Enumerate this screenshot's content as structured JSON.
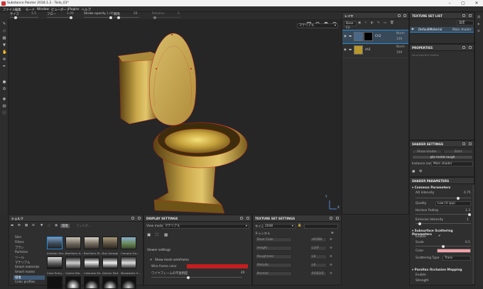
{
  "window": {
    "title": "Substance Painter 2018.1.2 - Toile_01*"
  },
  "menu": [
    "ファイル",
    "編集",
    "モード",
    "Window",
    "ビューポート",
    "Plugins",
    "ヘルプ"
  ],
  "toolbar": {
    "size_label": "サイズ",
    "size_value": "1.5",
    "flow_label": "フロー",
    "flow_value": "1.00",
    "stroke_opacity_label": "Stroke opacity",
    "stroke_opacity_value": "1.00",
    "spacing_label": "間隔",
    "spacing_value": "20",
    "rotation_label": "Rotation",
    "rotation_value": "0"
  },
  "viewport": {
    "mode": "マテリアル",
    "axis_y": "Y",
    "axis_x": "X"
  },
  "layers": {
    "title": "レイヤ",
    "blend": "Base Co",
    "items": [
      {
        "name": "Ch2",
        "blend": "Norm",
        "opacity": "100"
      },
      {
        "name": "ch1",
        "blend": "Norm",
        "opacity": "100"
      }
    ]
  },
  "texture_set_list": {
    "title": "TEXTURE SET LIST",
    "dropdown": "設定",
    "item": "DefaultMaterial",
    "shader": "Main shader"
  },
  "properties": {
    "title": "PROPERTIES",
    "empty": "No properties loaded"
  },
  "shader_settings": {
    "title": "SHADER SETTINGS",
    "buttons": [
      "Show shader",
      "Start"
    ],
    "shader_name": "pbr-metal-rough",
    "instance_label": "Instance name",
    "instance_value": "Main shader"
  },
  "shader_params": {
    "title": "SHADER PARAMETERS",
    "common": "Common Parameters",
    "ao_intensity_label": "AO Intensity",
    "ao_intensity_value": "0.75",
    "quality_label": "Quality",
    "quality_value": "Low (4 spp)",
    "emissive_label": "Emissive Intensity",
    "emissive_value": "1",
    "horizon_label": "Horizon Fading",
    "horizon_value": "1.3",
    "sss": "Subsurface Scattering Parameters",
    "enable_label": "Enable",
    "scale_label": "Scale",
    "scale_value": "0.5",
    "color_label": "Color",
    "scatter_type_label": "Scattering Type",
    "scatter_type_value": "Trans",
    "parallax": "Parallax Occlusion Mapping",
    "p_enable_label": "Enable",
    "strength_label": "Strength"
  },
  "shelf": {
    "title": "シェルフ",
    "tab_label": "環境",
    "search_placeholder": "フィルタ...",
    "categories": [
      "Skin",
      "Filters",
      "ブラシ",
      "Particles",
      "ツール",
      "マテリアル",
      "Smart materials",
      "Smart masks",
      "環境",
      "Color profiles"
    ],
    "selected_category": "環境",
    "items": [
      "Artesian Ser...",
      "Bonifacio A...",
      "Bonifacio St...",
      "Bus Garage",
      "Campus Go...",
      "Cave Entry...",
      "Contra Ste...",
      "Colorado Str...",
      "Glacier Park",
      "Monastatic S..."
    ]
  },
  "display_settings": {
    "title": "DISPLAY SETTINGS",
    "view_mode_label": "View mode",
    "view_mode_value": "マテリアル",
    "viewer_settings": "Viewer settings",
    "show_mesh_wireframe": "Show mesh wireframe",
    "wire_color_label": "Wire frame color",
    "wire_opacity_label": "ワイヤフレームの不透明度",
    "wire_opacity_value": "40"
  },
  "texture_set_settings": {
    "title": "TEXTURE SET SETTINGS",
    "size_label": "サイズ",
    "size_value": "2048",
    "channels_label": "チャンネル",
    "channels": [
      {
        "name": "Base Color",
        "format": "sRGB8"
      },
      {
        "name": "Height",
        "format": "L16F"
      },
      {
        "name": "Roughness",
        "format": "L8"
      },
      {
        "name": "Metallic",
        "format": "L8"
      },
      {
        "name": "Normal",
        "format": "RGB16F"
      }
    ]
  },
  "colors": {
    "accent": "#2a8ad4",
    "wire": "#c41e1e",
    "sss_color": "#f4a0a8",
    "gold": "#b8972d"
  }
}
